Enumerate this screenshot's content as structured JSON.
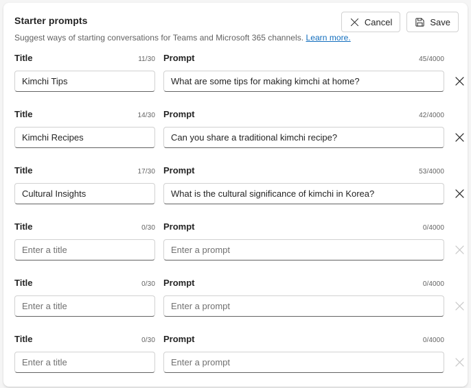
{
  "header": {
    "title": "Starter prompts",
    "subtitle_text": "Suggest ways of starting conversations for Teams and Microsoft 365 channels. ",
    "learn_more_label": "Learn more.",
    "cancel_label": "Cancel",
    "save_label": "Save",
    "cancel_icon": "close-icon",
    "save_icon": "save-floppy-icon"
  },
  "labels": {
    "title_label": "Title",
    "prompt_label": "Prompt",
    "title_placeholder": "Enter a title",
    "prompt_placeholder": "Enter a prompt",
    "delete_icon": "close-icon"
  },
  "colors": {
    "accent": "#0f6cbd",
    "text_primary": "#242424",
    "text_secondary": "#616161",
    "border": "#d1d1d1",
    "border_bottom": "#616161",
    "disabled": "#c8c8c8"
  },
  "rows": [
    {
      "title_value": "Kimchi Tips",
      "title_counter": "11/30",
      "prompt_value": "What are some tips for making kimchi at home?",
      "prompt_counter": "45/4000",
      "delete_enabled": true
    },
    {
      "title_value": "Kimchi Recipes",
      "title_counter": "14/30",
      "prompt_value": "Can you share a traditional kimchi recipe?",
      "prompt_counter": "42/4000",
      "delete_enabled": true
    },
    {
      "title_value": "Cultural Insights",
      "title_counter": "17/30",
      "prompt_value": "What is the cultural significance of kimchi in Korea?",
      "prompt_counter": "53/4000",
      "delete_enabled": true
    },
    {
      "title_value": "",
      "title_counter": "0/30",
      "prompt_value": "",
      "prompt_counter": "0/4000",
      "delete_enabled": false
    },
    {
      "title_value": "",
      "title_counter": "0/30",
      "prompt_value": "",
      "prompt_counter": "0/4000",
      "delete_enabled": false
    },
    {
      "title_value": "",
      "title_counter": "0/30",
      "prompt_value": "",
      "prompt_counter": "0/4000",
      "delete_enabled": false
    }
  ]
}
